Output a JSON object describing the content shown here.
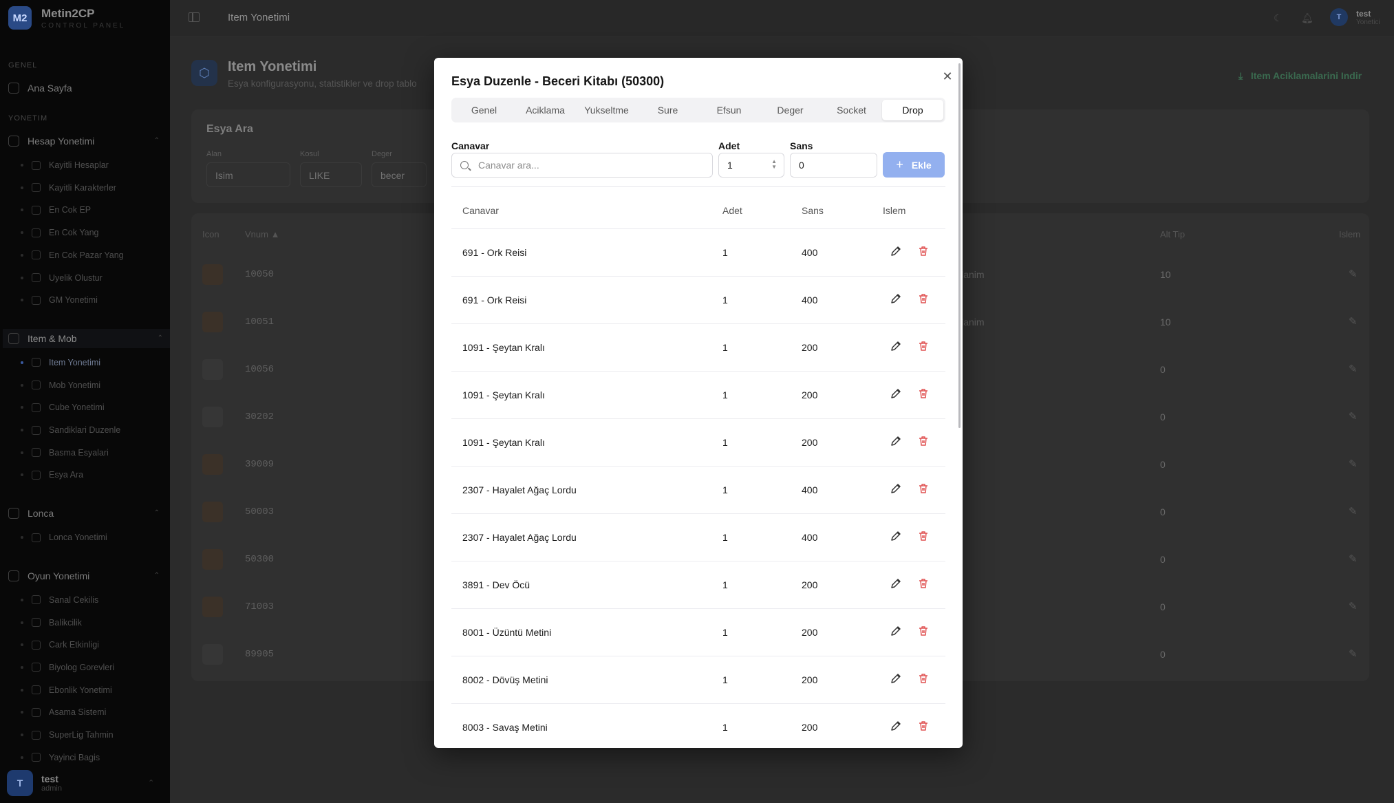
{
  "app": {
    "brand": "Metin2CP",
    "brand_sub": "CONTROL PANEL",
    "logo": "M2"
  },
  "sidebar": {
    "section_general": "GENEL",
    "home": "Ana Sayfa",
    "section_manage": "YONETIM",
    "groups": [
      {
        "label": "Hesap Yonetimi",
        "items": [
          "Kayitli Hesaplar",
          "Kayitli Karakterler",
          "En Cok EP",
          "En Cok Yang",
          "En Cok Pazar Yang",
          "Uyelik Olustur",
          "GM Yonetimi"
        ]
      },
      {
        "label": "Item & Mob",
        "items": [
          "Item Yonetimi",
          "Mob Yonetimi",
          "Cube Yonetimi",
          "Sandiklari Duzenle",
          "Basma Esyalari",
          "Esya Ara"
        ]
      },
      {
        "label": "Lonca",
        "items": [
          "Lonca Yonetimi"
        ]
      },
      {
        "label": "Oyun Yonetimi",
        "items": [
          "Sanal Cekilis",
          "Balikcilik",
          "Cark Etkinligi",
          "Biyolog Gorevleri",
          "Ebonlik Yonetimi",
          "Asama Sistemi",
          "SuperLig Tahmin",
          "Yayinci Bagis"
        ]
      }
    ],
    "user": {
      "name": "test",
      "role": "admin",
      "initial": "T"
    }
  },
  "header": {
    "title": "Item Yonetimi",
    "user": {
      "name": "test",
      "role": "Yonetici",
      "initial": "T"
    }
  },
  "page": {
    "title": "Item Yonetimi",
    "subtitle": "Esya konfigurasyonu, statistikler ve drop tablo",
    "download_label": "Item Aciklamalarini Indir",
    "search": {
      "title": "Esya Ara",
      "field_label": "Alan",
      "field_value": "Isim",
      "cond_label": "Kosul",
      "cond_value": "LIKE",
      "value_label": "Deger",
      "value_value": "becer"
    },
    "table": {
      "headers": {
        "icon": "Icon",
        "vnum": "Vnum ▲",
        "alt_tip": "Alt Tip",
        "islem": "Islem"
      },
      "rows": [
        {
          "vnum": "10050",
          "kk": "llanim",
          "alt": "10"
        },
        {
          "vnum": "10051",
          "kk": "llanim",
          "alt": "10"
        },
        {
          "vnum": "10056",
          "kk": "",
          "alt": "0"
        },
        {
          "vnum": "30202",
          "kk": "",
          "alt": "0"
        },
        {
          "vnum": "39009",
          "kk": "",
          "alt": "0"
        },
        {
          "vnum": "50003",
          "kk": "",
          "alt": "0"
        },
        {
          "vnum": "50300",
          "kk": "",
          "alt": "0"
        },
        {
          "vnum": "71003",
          "kk": "",
          "alt": "0"
        },
        {
          "vnum": "89905",
          "kk": "",
          "alt": "0"
        }
      ]
    }
  },
  "modal": {
    "title": "Esya Duzenle - Beceri Kitabı (50300)",
    "tabs": [
      "Genel",
      "Aciklama",
      "Yukseltme",
      "Sure",
      "Efsun",
      "Deger",
      "Socket",
      "Drop"
    ],
    "active_tab": "Drop",
    "form": {
      "monster_label": "Canavar",
      "monster_placeholder": "Canavar ara...",
      "count_label": "Adet",
      "count_value": "1",
      "chance_label": "Sans",
      "chance_value": "0",
      "add_label": "Ekle"
    },
    "table": {
      "headers": {
        "monster": "Canavar",
        "count": "Adet",
        "chance": "Sans",
        "action": "Islem"
      },
      "rows": [
        {
          "monster": "691 - Ork Reisi",
          "count": "1",
          "chance": "400"
        },
        {
          "monster": "691 - Ork Reisi",
          "count": "1",
          "chance": "400"
        },
        {
          "monster": "1091 - Şeytan Kralı",
          "count": "1",
          "chance": "200"
        },
        {
          "monster": "1091 - Şeytan Kralı",
          "count": "1",
          "chance": "200"
        },
        {
          "monster": "1091 - Şeytan Kralı",
          "count": "1",
          "chance": "200"
        },
        {
          "monster": "2307 - Hayalet Ağaç Lordu",
          "count": "1",
          "chance": "400"
        },
        {
          "monster": "2307 - Hayalet Ağaç Lordu",
          "count": "1",
          "chance": "400"
        },
        {
          "monster": "3891 - Dev Öcü",
          "count": "1",
          "chance": "200"
        },
        {
          "monster": "8001 - Üzüntü Metini",
          "count": "1",
          "chance": "200"
        },
        {
          "monster": "8002 - Dövüş Metini",
          "count": "1",
          "chance": "200"
        },
        {
          "monster": "8003 - Savaş Metini",
          "count": "1",
          "chance": "200"
        }
      ]
    },
    "colors": {
      "primary": "#93b0ef",
      "danger": "#e05252"
    }
  }
}
